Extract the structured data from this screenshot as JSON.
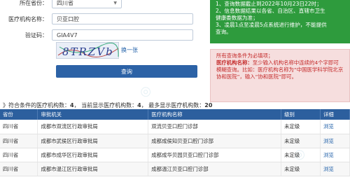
{
  "form": {
    "province_label": "所在省份：",
    "province_value": "四川省",
    "name_label": "医疗机构名称：",
    "name_value": "贝亚口腔",
    "code_label": "验证码：",
    "code_value": "GIA4V7",
    "captcha_text": "8TRZVb",
    "refresh_label": "换一张",
    "query_button": "查询"
  },
  "notes": {
    "green_lines": [
      "1、查询数据截止到2022年10月23日22时；",
      "2、信息数据结果以各省、自治区、直辖市卫生",
      "健康委数据为准；",
      "3、凌晨1点至凌晨5点系统进行维护，不能提供",
      "查询。"
    ],
    "red_intro": "所有查询条件为必填项；",
    "red_bold": "医疗机构名称：",
    "red_rest": "至少输入机构名称中连续的4个字即可模糊查询。比如：医疗机构名称为“中国医学科学院北京协和医院”，输入“协和医院”即可。"
  },
  "summary": {
    "prefix": "》符合条件的医疗机构数：",
    "total": "4",
    "mid": "，  当前显示医疗机构数：",
    "shown": "4",
    "tail": "，  最多显示医疗机构数：",
    "max": "20"
  },
  "table": {
    "headers": [
      "省份",
      "审批机关",
      "医疗机构名称",
      "级别",
      "详细"
    ],
    "rows": [
      [
        "四川省",
        "成都市双流区行政审批局",
        "双流贝亚口腔门诊部",
        "未定级",
        "浏览"
      ],
      [
        "四川省",
        "成都市武侯区行政审批局",
        "成都成侯知贝亚口腔门诊部",
        "未定级",
        "浏览"
      ],
      [
        "四川省",
        "成都市成华区行政审批局",
        "成都成华贝园贝亚口腔门诊部",
        "未定级",
        "浏览"
      ],
      [
        "四川省",
        "成都市温江区行政审批局",
        "成都温江贝亚口腔门诊部",
        "未定级",
        "浏览"
      ]
    ]
  }
}
